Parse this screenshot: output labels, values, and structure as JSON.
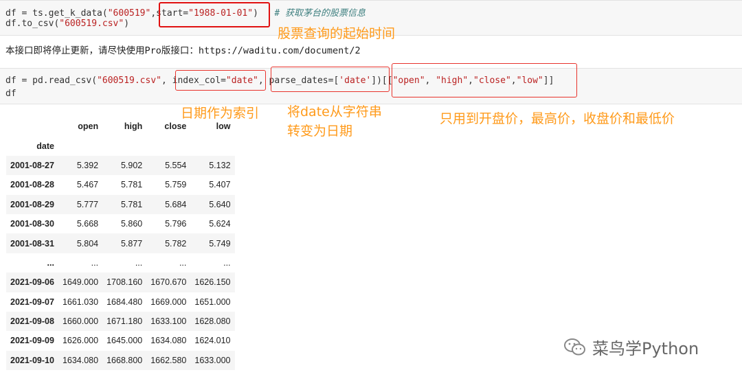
{
  "cell1": {
    "line1_pre": "df = ts.get_k_data(",
    "line1_str": "\"600519\"",
    "line1_comma": ",",
    "line1_start": "start=",
    "line1_date": "\"1988-01-01\"",
    "line1_close": ")",
    "line1_comment": "# 获取茅台的股票信息",
    "line2_pre": "df.to_csv(",
    "line2_str": "\"600519.csv\"",
    "line2_close": ")"
  },
  "anno_start": "股票查询的起始时间",
  "notice": "本接口即将停止更新，请尽快使用Pro版接口：https://waditu.com/document/2",
  "cell2": {
    "line1_pre": "df = pd.read_csv(",
    "line1_str": "\"600519.csv\"",
    "line1_comma": ", ",
    "index_kw": "index_col=",
    "index_val": "\"date\"",
    "comma2": ",",
    "parse_kw": " parse_dates=[",
    "parse_val": "'date'",
    "parse_close": "])",
    "cols_open": "[[",
    "col_open": "\"open\"",
    "col_sep1": ", ",
    "col_high": "\"high\"",
    "col_sep2": ",",
    "col_close": "\"close\"",
    "col_sep3": ",",
    "col_low": "\"low\"",
    "cols_close": "]]",
    "line2": "df"
  },
  "anno_index": "日期作为索引",
  "anno_parse_1": "将date从字符串",
  "anno_parse_2": "转变为日期",
  "anno_cols": "只用到开盘价，最高价，收盘价和最低价",
  "table": {
    "columns": [
      "open",
      "high",
      "close",
      "low"
    ],
    "index_name": "date",
    "rows": [
      [
        "2001-08-27",
        "5.392",
        "5.902",
        "5.554",
        "5.132"
      ],
      [
        "2001-08-28",
        "5.467",
        "5.781",
        "5.759",
        "5.407"
      ],
      [
        "2001-08-29",
        "5.777",
        "5.781",
        "5.684",
        "5.640"
      ],
      [
        "2001-08-30",
        "5.668",
        "5.860",
        "5.796",
        "5.624"
      ],
      [
        "2001-08-31",
        "5.804",
        "5.877",
        "5.782",
        "5.749"
      ],
      [
        "...",
        "...",
        "...",
        "...",
        "..."
      ],
      [
        "2021-09-06",
        "1649.000",
        "1708.160",
        "1670.670",
        "1626.150"
      ],
      [
        "2021-09-07",
        "1661.030",
        "1684.480",
        "1669.000",
        "1651.000"
      ],
      [
        "2021-09-08",
        "1660.000",
        "1671.180",
        "1633.100",
        "1628.080"
      ],
      [
        "2021-09-09",
        "1626.000",
        "1645.000",
        "1634.080",
        "1624.010"
      ],
      [
        "2021-09-10",
        "1634.080",
        "1668.800",
        "1662.580",
        "1633.000"
      ]
    ]
  },
  "watermark": "菜鸟学Python",
  "colors": {
    "annotation": "#ff9a1a",
    "box": "#e8322b",
    "string": "#ba2121",
    "comment": "#408080"
  }
}
